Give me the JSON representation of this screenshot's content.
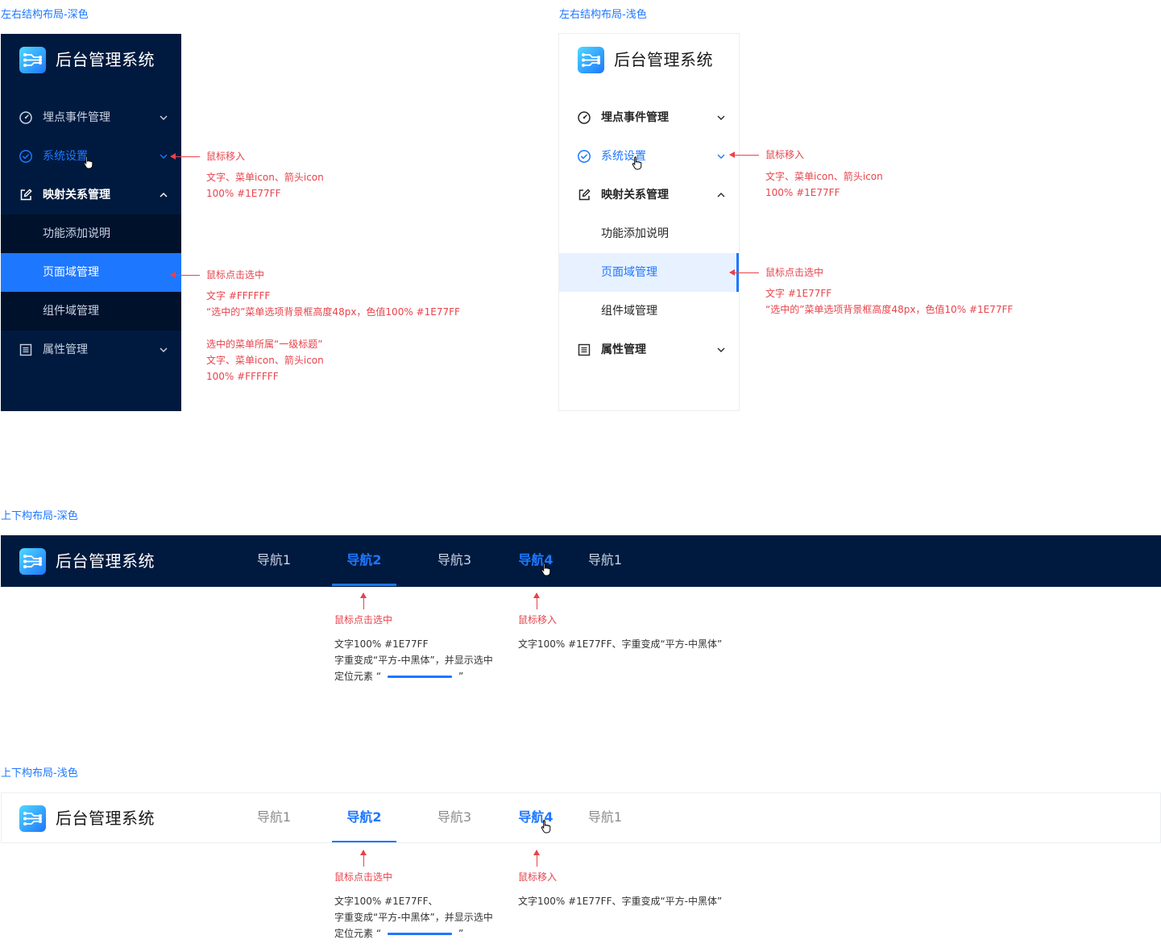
{
  "colors": {
    "accent": "#1E77FF",
    "dark_bg": "#001A3F",
    "annotation": "#E8434B",
    "white": "#FFFFFF"
  },
  "sections": {
    "side_dark": "左右结构布局-深色",
    "side_light": "左右结构布局-浅色",
    "top_dark": "上下构布局-深色",
    "top_light": "上下构布局-浅色"
  },
  "app": {
    "title": "后台管理系统",
    "logo_icon": "network-logo-icon"
  },
  "side_menu": {
    "items": [
      {
        "label": "埋点事件管理",
        "icon": "dashboard-gauge-icon",
        "arrow": "chevron-down-icon"
      },
      {
        "label": "系统设置",
        "icon": "check-circle-icon",
        "arrow": "chevron-down-icon",
        "state": "hover"
      },
      {
        "label": "映射关系管理",
        "icon": "edit-icon",
        "arrow": "chevron-up-icon",
        "state": "expanded"
      },
      {
        "label": "功能添加说明"
      },
      {
        "label": "页面域管理",
        "state": "selected"
      },
      {
        "label": "组件域管理"
      },
      {
        "label": "属性管理",
        "icon": "list-icon",
        "arrow": "chevron-down-icon"
      }
    ]
  },
  "annotations_dark_side": {
    "hover_title": "鼠标移入",
    "hover_line1": "文字、菜单icon、箭头icon",
    "hover_line2": "100% #1E77FF",
    "select_title": "鼠标点击选中",
    "select_line1": "文字 #FFFFFF",
    "select_line2": "“选中的”菜单选项背景框高度48px，色值100% #1E77FF",
    "parent_line1": "选中的菜单所属“一级标题”",
    "parent_line2": "文字、菜单icon、箭头icon",
    "parent_line3": "100% #FFFFFF"
  },
  "annotations_light_side": {
    "hover_title": "鼠标移入",
    "hover_line1": "文字、菜单icon、箭头icon",
    "hover_line2": "100% #1E77FF",
    "select_title": "鼠标点击选中",
    "select_line1": "文字 #1E77FF",
    "select_line2": "“选中的”菜单选项背景框高度48px，色值10% #1E77FF"
  },
  "top_nav": {
    "items": [
      {
        "label": "导航1"
      },
      {
        "label": "导航2",
        "state": "active"
      },
      {
        "label": "导航3"
      },
      {
        "label": "导航4",
        "state": "hover"
      },
      {
        "label": "导航1"
      }
    ]
  },
  "annotations_top_dark": {
    "select_title": "鼠标点击选中",
    "select_line1": "文字100% #1E77FF",
    "select_line2": "字重变成“平方-中黑体”，并显示选中",
    "select_line3_pre": "定位元素 “",
    "select_line3_post": "”",
    "hover_title": "鼠标移入",
    "hover_line1": "文字100% #1E77FF、字重变成“平方-中黑体”"
  },
  "annotations_top_light": {
    "select_title": "鼠标点击选中",
    "select_line1": "文字100% #1E77FF、",
    "select_line2": "字重变成“平方-中黑体”，并显示选中",
    "select_line3_pre": "定位元素 “",
    "select_line3_post": "”",
    "hover_title": "鼠标移入",
    "hover_line1": "文字100% #1E77FF、字重变成“平方-中黑体”"
  }
}
